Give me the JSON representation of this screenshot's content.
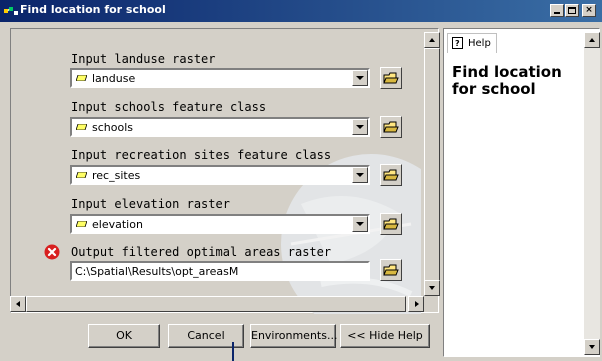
{
  "window": {
    "title": "Find location for school",
    "controls": [
      "minimize",
      "maximize",
      "close"
    ]
  },
  "form": {
    "fields": [
      {
        "label": "Input landuse raster",
        "value": "landuse",
        "type": "raster-combo"
      },
      {
        "label": "Input schools feature class",
        "value": "schools",
        "type": "feature-combo"
      },
      {
        "label": "Input recreation sites feature class",
        "value": "rec_sites",
        "type": "feature-combo"
      },
      {
        "label": "Input elevation raster",
        "value": "elevation",
        "type": "raster-combo"
      },
      {
        "label": "Output filtered optimal areas raster",
        "value": "C:\\Spatial\\Results\\opt_areasM",
        "type": "text",
        "error": true
      }
    ]
  },
  "buttons": {
    "ok": "OK",
    "cancel": "Cancel",
    "environments": "Environments...",
    "hide_help": "<< Hide Help"
  },
  "help": {
    "tab_label": "Help",
    "heading": "Find location for school"
  },
  "colors": {
    "titlebar_start": "#0a246a",
    "titlebar_end": "#3a6ea5",
    "dialog_bg": "#d4d0c8",
    "error_red": "#d82020"
  }
}
